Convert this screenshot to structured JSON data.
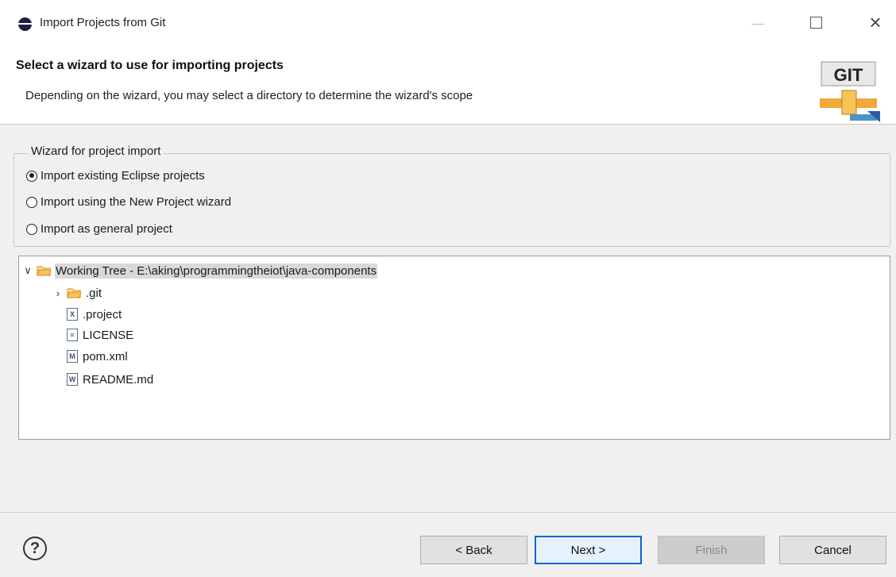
{
  "window": {
    "title": "Import Projects from Git",
    "close_glyph": "×"
  },
  "header": {
    "title": "Select a wizard to use for importing projects",
    "description": "Depending on the wizard, you may select a directory to determine the wizard's scope",
    "logo_text": "GIT"
  },
  "wizard_group": {
    "legend": "Wizard for project import",
    "options": [
      {
        "label": "Import existing Eclipse projects",
        "checked": true
      },
      {
        "label": "Import using the New Project wizard",
        "checked": false
      },
      {
        "label": "Import as general project",
        "checked": false
      }
    ]
  },
  "tree": {
    "root": {
      "label": "Working Tree - E:\\aking\\programmingtheiot\\java-components",
      "expanded": true,
      "selected": true
    },
    "children": [
      {
        "label": ".git",
        "type": "folder",
        "expandable": true
      },
      {
        "label": ".project",
        "type": "file",
        "badge": "X"
      },
      {
        "label": "LICENSE",
        "type": "file",
        "badge": "≡"
      },
      {
        "label": "pom.xml",
        "type": "file",
        "badge": "M"
      },
      {
        "label": "README.md",
        "type": "file",
        "badge": "W"
      }
    ]
  },
  "buttons": {
    "help": "?",
    "back": "< Back",
    "next": "Next >",
    "finish": "Finish",
    "cancel": "Cancel"
  },
  "colors": {
    "default_button_border": "#0a65d8",
    "selection": "#d9d9d9",
    "folder": "#f2a83a"
  }
}
